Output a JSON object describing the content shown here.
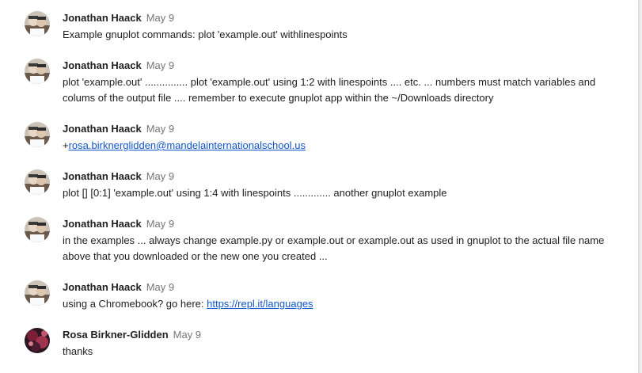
{
  "comments": [
    {
      "author": "Jonathan Haack",
      "date": "May 9",
      "avatar": "jonathan-avatar",
      "text": "Example gnuplot commands: plot 'example.out' withlinespoints"
    },
    {
      "author": "Jonathan Haack",
      "date": "May 9",
      "avatar": "jonathan-avatar",
      "text": "plot 'example.out' ............... plot 'example.out' using 1:2 with linespoints .... etc. ... numbers must match variables and colums of the output file .... remember to execute gnuplot app within the ~/Downloads directory"
    },
    {
      "author": "Jonathan Haack",
      "date": "May 9",
      "avatar": "jonathan-avatar",
      "text_prefix": "+",
      "link": "rosa.birknerglidden@mandelainternationalschool.us"
    },
    {
      "author": "Jonathan Haack",
      "date": "May 9",
      "avatar": "jonathan-avatar",
      "text": "plot [] [0:1] 'example.out' using 1:4 with linespoints ............. another gnuplot example"
    },
    {
      "author": "Jonathan Haack",
      "date": "May 9",
      "avatar": "jonathan-avatar",
      "text": "in the examples ... always change example.py or example.out or example.out as used in gnuplot to the actual file name above that you downloaded or the new one you created ..."
    },
    {
      "author": "Jonathan Haack",
      "date": "May 9",
      "avatar": "jonathan-avatar",
      "text_prefix": "using a Chromebook? go here: ",
      "link": "https://repl.it/languages"
    },
    {
      "author": "Rosa Birkner-Glidden",
      "date": "May 9",
      "avatar": "rosa-avatar",
      "text": "thanks"
    }
  ],
  "colors": {
    "author": "#212121",
    "date": "#757575",
    "link": "#1155cc",
    "background": "#ffffff"
  }
}
